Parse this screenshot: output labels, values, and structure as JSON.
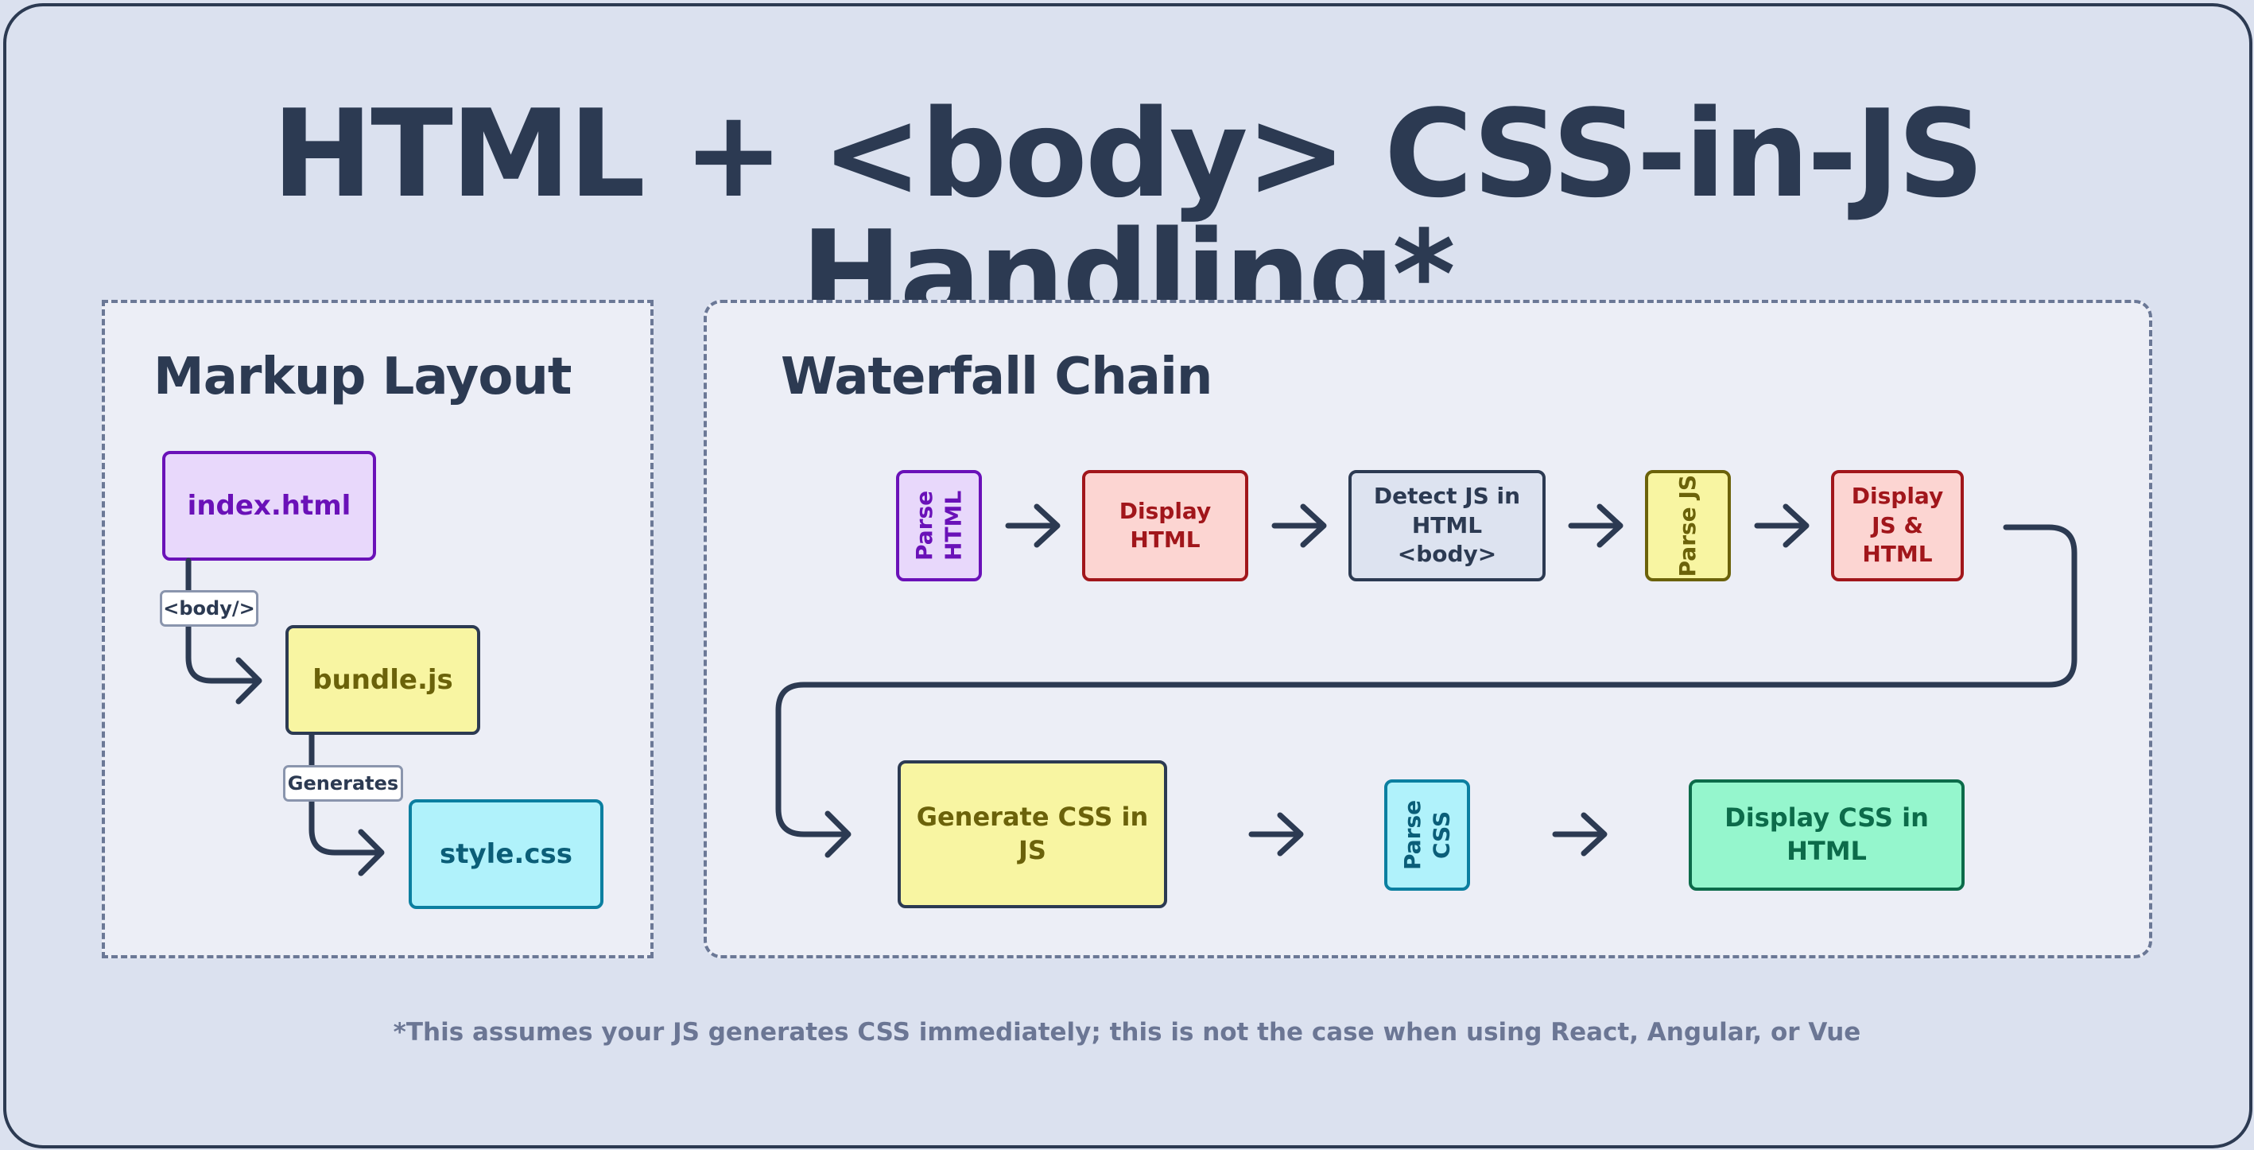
{
  "title": "HTML + <body> CSS-in-JS Handling*",
  "markup_panel": {
    "title": "Markup Layout",
    "index": "index.html",
    "body_tag": "<body/>",
    "bundle": "bundle.js",
    "generates_tag": "Generates",
    "style": "style.css"
  },
  "waterfall_panel": {
    "title": "Waterfall Chain",
    "steps": [
      "Parse HTML",
      "Display HTML",
      "Detect JS in HTML <body>",
      "Parse JS",
      "Display JS & HTML",
      "Generate CSS in JS",
      "Parse CSS",
      "Display CSS in HTML"
    ]
  },
  "footnote": "*This assumes your JS generates CSS immediately; this is not the case when using React, Angular, or Vue",
  "colors": {
    "ink": "#2c3a52",
    "purple": "#6a11b8",
    "red": "#a1161b",
    "yellow": "#6b620a",
    "cyan": "#0b5e78",
    "green": "#0c6b4a"
  }
}
